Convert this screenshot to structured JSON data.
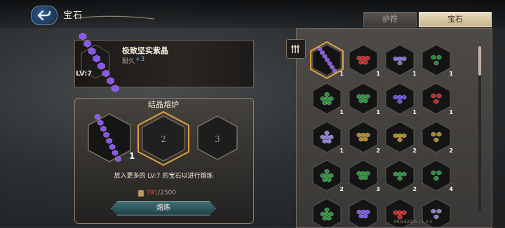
{
  "header": {
    "title": "宝石"
  },
  "tabs": [
    {
      "label": "护符",
      "active": false
    },
    {
      "label": "宝石",
      "active": true
    }
  ],
  "selected_item": {
    "name": "极致坚实紫晶",
    "durability_label": "耐久",
    "durability_value": "+3",
    "level": "LV:7"
  },
  "furnace": {
    "title": "结晶熔炉",
    "slots": [
      {
        "count": "1",
        "filled": true,
        "gem_color": "#8a55f0"
      },
      {
        "number": "2",
        "filled": false
      },
      {
        "number": "3",
        "filled": false
      }
    ],
    "hint": "放入更多的 LV:7 的宝石以进行熔炼",
    "cost_have": "391",
    "cost_need": "/2500",
    "button_label": "熔炼"
  },
  "gem_grid": [
    {
      "color": "#8a55f0",
      "count": "1",
      "selected": true
    },
    {
      "color": "#c42b2b",
      "count": "1"
    },
    {
      "color": "#7f6fc8",
      "count": "1"
    },
    {
      "color": "#2d8a3a",
      "count": "1"
    },
    {
      "color": "#2f8f3c",
      "count": "1"
    },
    {
      "color": "#2f8f3c",
      "count": "1"
    },
    {
      "color": "#6a4fd0",
      "count": "1"
    },
    {
      "color": "#c42b2b",
      "count": "1"
    },
    {
      "color": "#8a80c8",
      "count": "1"
    },
    {
      "color": "#b08a1e",
      "count": "2"
    },
    {
      "color": "#b08a1e",
      "count": "2"
    },
    {
      "color": "#b08a1e",
      "count": "2"
    },
    {
      "color": "#2f8f3c",
      "count": "2"
    },
    {
      "color": "#2f8f3c",
      "count": "3"
    },
    {
      "color": "#2f8f3c",
      "count": "2"
    },
    {
      "color": "#2f8f3c",
      "count": "4"
    },
    {
      "color": "#2f8f3c",
      "count": ""
    },
    {
      "color": "#7a5ae0",
      "count": ""
    },
    {
      "color": "#c42b2b",
      "count": ""
    },
    {
      "color": "#8a80c8",
      "count": ""
    }
  ],
  "footer": {
    "pid": "PID542025 | 1.3.4"
  },
  "colors": {
    "accent": "#d9a14a",
    "cost_have": "#e0533c",
    "durability": "#6fb8ff"
  }
}
